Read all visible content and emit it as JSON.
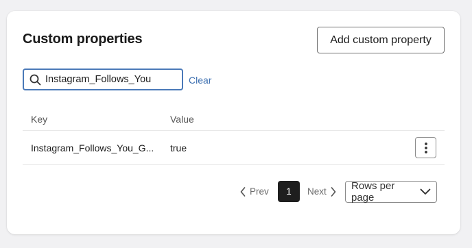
{
  "card": {
    "title": "Custom properties",
    "add_button_label": "Add custom property"
  },
  "search": {
    "value": "Instagram_Follows_You",
    "clear_label": "Clear",
    "icon": "search-icon"
  },
  "table": {
    "headers": [
      "Key",
      "Value"
    ],
    "rows": [
      {
        "key": "Instagram_Follows_You_G...",
        "value": "true"
      }
    ]
  },
  "pagination": {
    "prev_label": "Prev",
    "next_label": "Next",
    "current_page": "1",
    "rows_per_page_label": "Rows per page"
  },
  "colors": {
    "accent": "#3c6fb0",
    "focus_border": "#4a79b8",
    "active_page_bg": "#1e1e1e",
    "page_bg": "#f1f1f3"
  }
}
